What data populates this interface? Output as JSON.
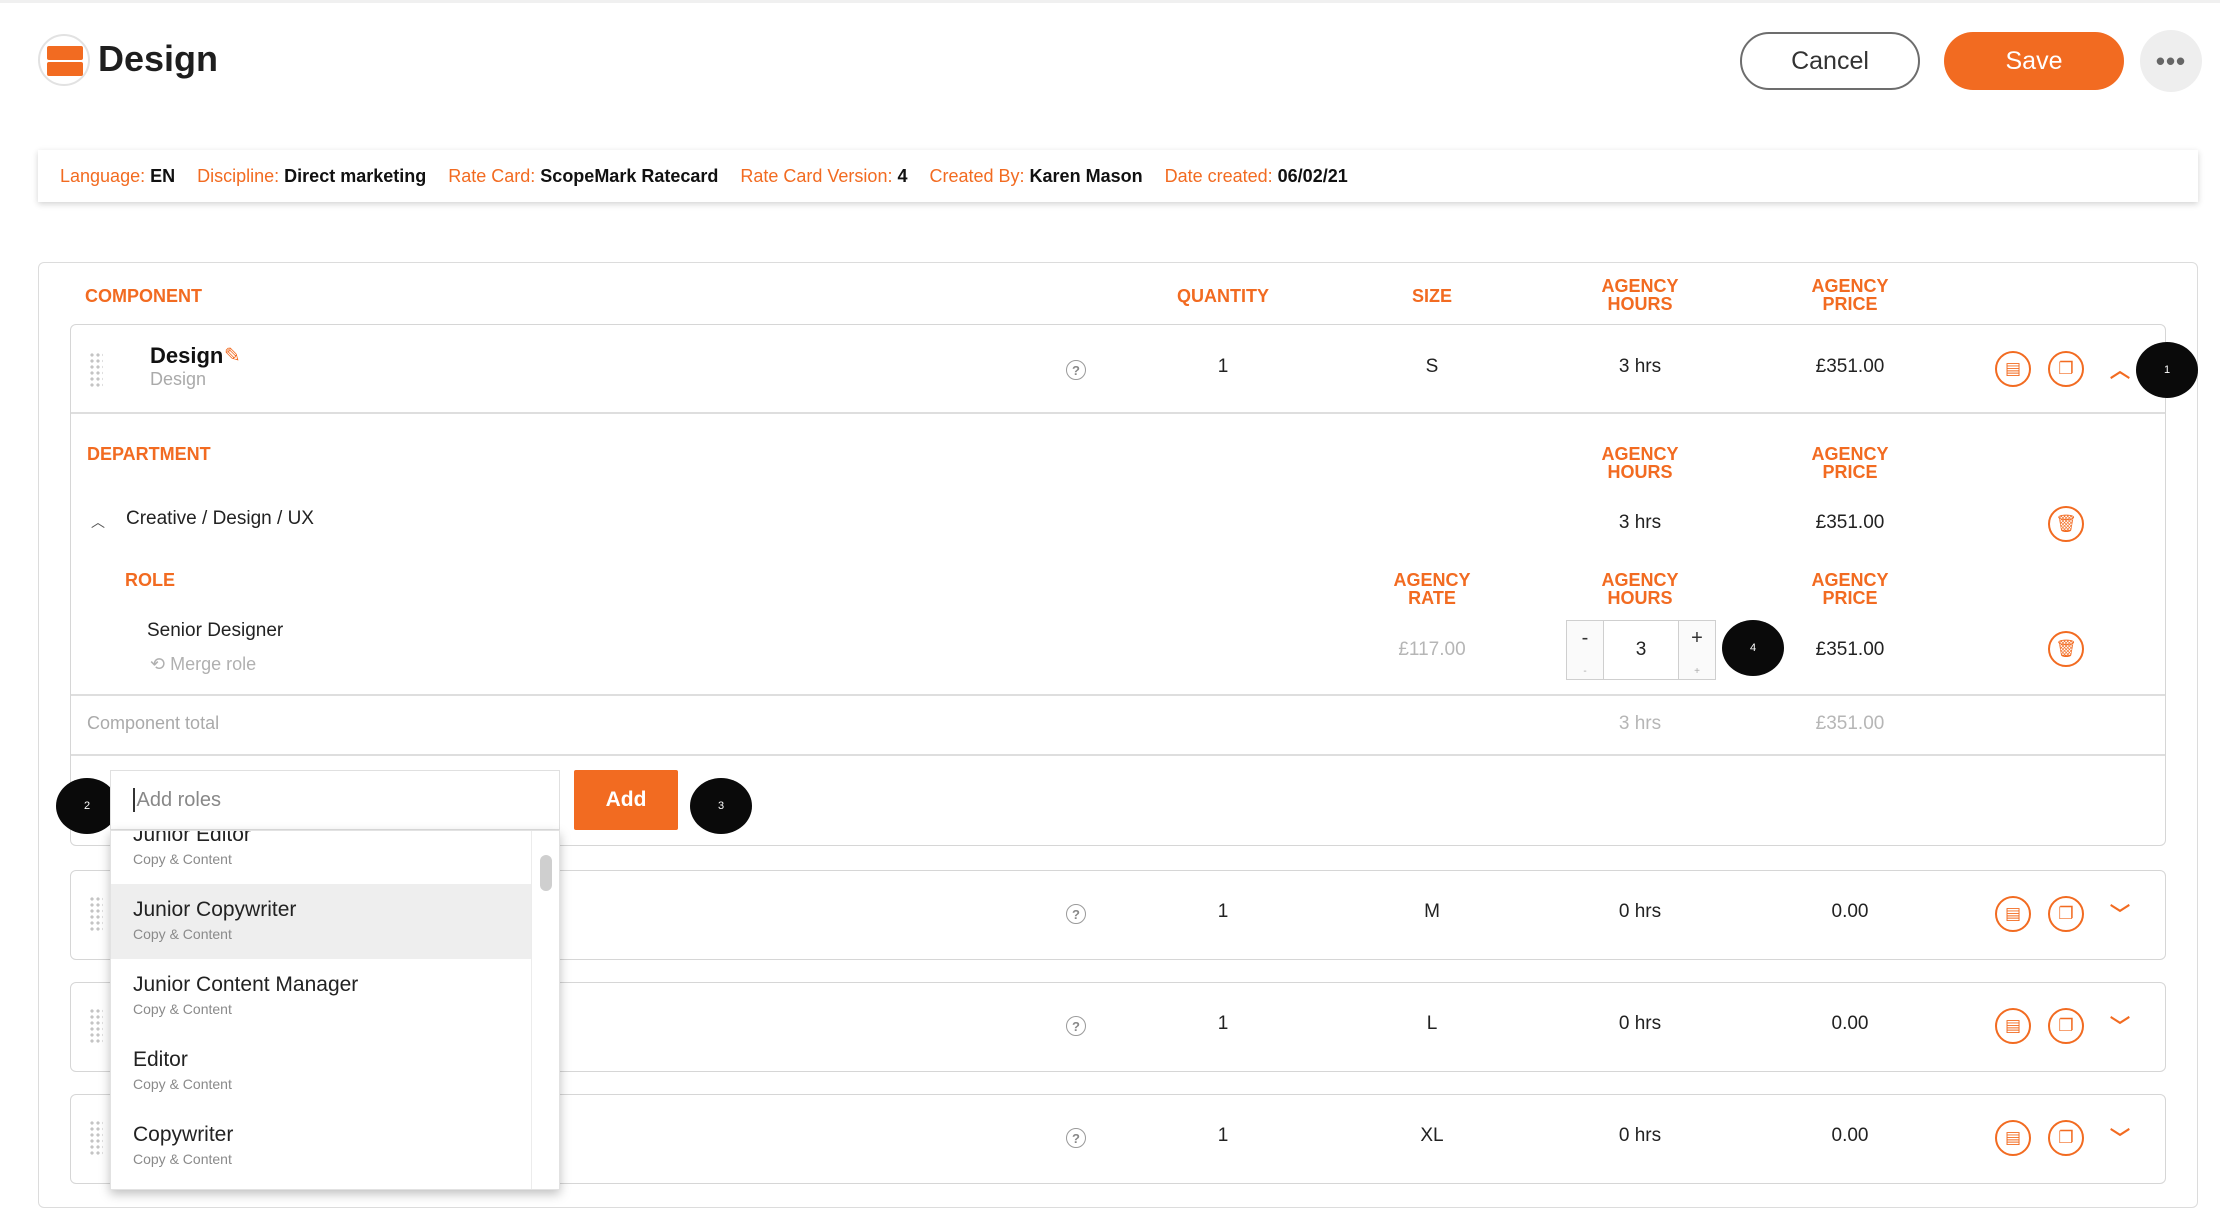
{
  "header": {
    "title": "Design",
    "cancel_label": "Cancel",
    "save_label": "Save",
    "more_label": "•••"
  },
  "meta": [
    {
      "label": "Language:",
      "value": "EN"
    },
    {
      "label": "Discipline:",
      "value": "Direct marketing"
    },
    {
      "label": "Rate Card:",
      "value": "ScopeMark Ratecard"
    },
    {
      "label": "Rate Card Version:",
      "value": "4"
    },
    {
      "label": "Created By:",
      "value": "Karen Mason"
    },
    {
      "label": "Date created:",
      "value": "06/02/21"
    }
  ],
  "table_headers": {
    "component": "COMPONENT",
    "quantity": "QUANTITY",
    "size": "SIZE",
    "agency_hours_1": "AGENCY",
    "agency_hours_2": "HOURS",
    "agency_price_1": "AGENCY",
    "agency_price_2": "PRICE",
    "agency_rate_1": "AGENCY",
    "agency_rate_2": "RATE",
    "department": "DEPARTMENT",
    "role": "ROLE"
  },
  "expanded_component": {
    "name": "Design",
    "subtitle": "Design",
    "quantity": "1",
    "size": "S",
    "hours": "3 hrs",
    "price": "£351.00",
    "department": {
      "name": "Creative / Design / UX",
      "hours": "3 hrs",
      "price": "£351.00"
    },
    "role": {
      "name": "Senior Designer",
      "merge_label": "Merge role",
      "rate": "£117.00",
      "hours_value": "3",
      "minus": "-",
      "plus": "+",
      "price": "£351.00"
    },
    "total": {
      "label": "Component total",
      "hours": "3 hrs",
      "price": "£351.00"
    }
  },
  "add_roles": {
    "placeholder": "Add roles",
    "button_label": "Add",
    "options": [
      {
        "title": "Junior Editor",
        "category": "Copy & Content",
        "selected": false
      },
      {
        "title": "Junior Copywriter",
        "category": "Copy & Content",
        "selected": true
      },
      {
        "title": "Junior Content Manager",
        "category": "Copy & Content",
        "selected": false
      },
      {
        "title": "Editor",
        "category": "Copy & Content",
        "selected": false
      },
      {
        "title": "Copywriter",
        "category": "Copy & Content",
        "selected": false
      }
    ]
  },
  "other_components": [
    {
      "quantity": "1",
      "size": "M",
      "hours": "0 hrs",
      "price": "0.00"
    },
    {
      "quantity": "1",
      "size": "L",
      "hours": "0 hrs",
      "price": "0.00"
    },
    {
      "quantity": "1",
      "size": "XL",
      "hours": "0 hrs",
      "price": "0.00"
    }
  ],
  "markers": [
    "1",
    "2",
    "3",
    "4"
  ],
  "colors": {
    "accent": "#f26b21",
    "marker": "#0a0a0a"
  }
}
